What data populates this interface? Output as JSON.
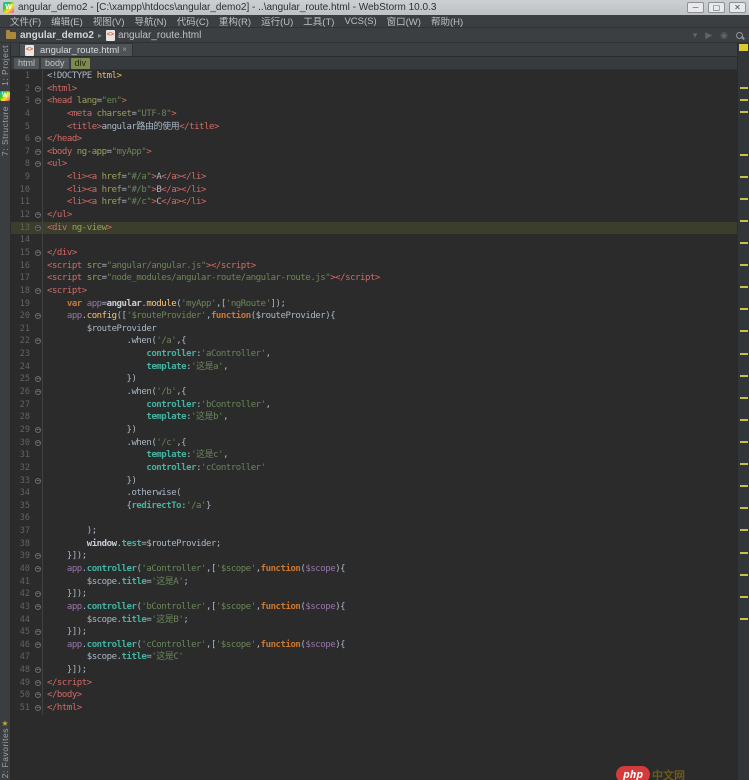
{
  "window": {
    "title": "angular_demo2 - [C:\\xampp\\htdocs\\angular_demo2] - ..\\angular_route.html - WebStorm 10.0.3",
    "minimize": "─",
    "maximize": "▢",
    "close": "✕"
  },
  "menu": {
    "items": [
      "文件(F)",
      "编辑(E)",
      "视图(V)",
      "导航(N)",
      "代码(C)",
      "重构(R)",
      "运行(U)",
      "工具(T)",
      "VCS(S)",
      "窗口(W)",
      "帮助(H)"
    ]
  },
  "navbar": {
    "project": "angular_demo2",
    "separator": "▸",
    "file": "angular_route.html",
    "file_icon_glyph": "<>",
    "right_icons": [
      "run-config-dropdown",
      "run",
      "stop",
      "search"
    ]
  },
  "tabs": [
    {
      "label": "angular_route.html",
      "close": "×",
      "active": true
    }
  ],
  "breadcrumbs": [
    {
      "label": "html",
      "selected": false
    },
    {
      "label": "body",
      "selected": false
    },
    {
      "label": "div",
      "selected": true
    }
  ],
  "tool_windows": {
    "left_top": [
      "1: Project",
      "7: Structure"
    ],
    "left_bottom": [
      "2: Favorites"
    ],
    "webstorm_badge": "W",
    "favorites_star": "★"
  },
  "editor": {
    "active_line": 13,
    "fold_lines": [
      2,
      3,
      6,
      7,
      8,
      12,
      13,
      15,
      18,
      20,
      22,
      25,
      26,
      29,
      30,
      33,
      39,
      40,
      42,
      43,
      45,
      46,
      48,
      49,
      50,
      51
    ],
    "lines": [
      [
        [
          "pl",
          "<!DOCTYPE "
        ],
        [
          "yel",
          "html>"
        ]
      ],
      [
        [
          "tag",
          "<html>"
        ]
      ],
      [
        [
          "tag",
          "<head"
        ],
        [
          "attr",
          " lang"
        ],
        [
          "pl",
          "="
        ],
        [
          "str",
          "\"en\""
        ],
        [
          "tag",
          ">"
        ]
      ],
      [
        [
          "pl",
          "    "
        ],
        [
          "tag",
          "<meta"
        ],
        [
          "attr",
          " charset"
        ],
        [
          "pl",
          "="
        ],
        [
          "str",
          "\"UTF-8\""
        ],
        [
          "tag",
          ">"
        ]
      ],
      [
        [
          "pl",
          "    "
        ],
        [
          "tag",
          "<title>"
        ],
        [
          "pl",
          "angular路由的使用"
        ],
        [
          "tag",
          "</title>"
        ]
      ],
      [
        [
          "tag",
          "</head>"
        ]
      ],
      [
        [
          "tag",
          "<body"
        ],
        [
          "attr",
          " ng-app"
        ],
        [
          "pl",
          "="
        ],
        [
          "str",
          "\"myApp\""
        ],
        [
          "tag",
          ">"
        ]
      ],
      [
        [
          "tag",
          "<ul>"
        ]
      ],
      [
        [
          "pl",
          "    "
        ],
        [
          "tag",
          "<li><a"
        ],
        [
          "attr",
          " href"
        ],
        [
          "pl",
          "="
        ],
        [
          "str",
          "\"#/a\""
        ],
        [
          "tag",
          ">"
        ],
        [
          "pl",
          "A"
        ],
        [
          "tag",
          "</a></li>"
        ]
      ],
      [
        [
          "pl",
          "    "
        ],
        [
          "tag",
          "<li><a"
        ],
        [
          "attr",
          " href"
        ],
        [
          "pl",
          "="
        ],
        [
          "str",
          "\"#/b\""
        ],
        [
          "tag",
          ">"
        ],
        [
          "pl",
          "B"
        ],
        [
          "tag",
          "</a></li>"
        ]
      ],
      [
        [
          "pl",
          "    "
        ],
        [
          "tag",
          "<li><a"
        ],
        [
          "attr",
          " href"
        ],
        [
          "pl",
          "="
        ],
        [
          "str",
          "\"#/c\""
        ],
        [
          "tag",
          ">"
        ],
        [
          "pl",
          "C"
        ],
        [
          "tag",
          "</a></li>"
        ]
      ],
      [
        [
          "tag",
          "</ul>"
        ]
      ],
      [
        [
          "tag",
          "<div"
        ],
        [
          "attr",
          " ng-view"
        ],
        [
          "tag",
          ">"
        ]
      ],
      [],
      [
        [
          "tag",
          "</div>"
        ]
      ],
      [
        [
          "tag",
          "<script"
        ],
        [
          "attr",
          " src"
        ],
        [
          "pl",
          "="
        ],
        [
          "str",
          "\"angular/angular.js\""
        ],
        [
          "tag",
          "></script>"
        ]
      ],
      [
        [
          "tag",
          "<script"
        ],
        [
          "attr",
          " src"
        ],
        [
          "pl",
          "="
        ],
        [
          "str",
          "\"node_modules/angular-route/angular-route.js\""
        ],
        [
          "tag",
          "></script>"
        ]
      ],
      [
        [
          "tag",
          "<script>"
        ]
      ],
      [
        [
          "pl",
          "    "
        ],
        [
          "kw",
          "var "
        ],
        [
          "glob",
          "app"
        ],
        [
          "pl",
          "="
        ],
        [
          "wb",
          "angular"
        ],
        [
          "pl",
          "."
        ],
        [
          "fn",
          "module"
        ],
        [
          "pl",
          "("
        ],
        [
          "str",
          "'myApp'"
        ],
        [
          "pl",
          ",["
        ],
        [
          "str",
          "'ngRoute'"
        ],
        [
          "pl",
          "]);"
        ]
      ],
      [
        [
          "pl",
          "    "
        ],
        [
          "glob",
          "app"
        ],
        [
          "pl",
          "."
        ],
        [
          "fn",
          "config"
        ],
        [
          "pl",
          "(["
        ],
        [
          "str",
          "'$routeProvider'"
        ],
        [
          "pl",
          ","
        ],
        [
          "kw",
          "function"
        ],
        [
          "pl",
          "($routeProvider){"
        ]
      ],
      [
        [
          "pl",
          "        $routeProvider"
        ]
      ],
      [
        [
          "pl",
          "                .when("
        ],
        [
          "str",
          "'/a'"
        ],
        [
          "pl",
          ",{"
        ]
      ],
      [
        [
          "pl",
          "                    "
        ],
        [
          "prop",
          "controller"
        ],
        [
          "pl",
          ":"
        ],
        [
          "str",
          "'aController'"
        ],
        [
          "pl",
          ","
        ]
      ],
      [
        [
          "pl",
          "                    "
        ],
        [
          "prop",
          "template"
        ],
        [
          "pl",
          ":"
        ],
        [
          "str",
          "'这是a'"
        ],
        [
          "pl",
          ","
        ]
      ],
      [
        [
          "pl",
          "                })"
        ]
      ],
      [
        [
          "pl",
          "                .when("
        ],
        [
          "str",
          "'/b'"
        ],
        [
          "pl",
          ",{"
        ]
      ],
      [
        [
          "pl",
          "                    "
        ],
        [
          "prop",
          "controller"
        ],
        [
          "pl",
          ":"
        ],
        [
          "str",
          "'bController'"
        ],
        [
          "pl",
          ","
        ]
      ],
      [
        [
          "pl",
          "                    "
        ],
        [
          "prop",
          "template"
        ],
        [
          "pl",
          ":"
        ],
        [
          "str",
          "'这是b'"
        ],
        [
          "pl",
          ","
        ]
      ],
      [
        [
          "pl",
          "                })"
        ]
      ],
      [
        [
          "pl",
          "                .when("
        ],
        [
          "str",
          "'/c'"
        ],
        [
          "pl",
          ",{"
        ]
      ],
      [
        [
          "pl",
          "                    "
        ],
        [
          "prop",
          "template"
        ],
        [
          "pl",
          ":"
        ],
        [
          "str",
          "'这是c'"
        ],
        [
          "pl",
          ","
        ]
      ],
      [
        [
          "pl",
          "                    "
        ],
        [
          "prop",
          "controller"
        ],
        [
          "pl",
          ":"
        ],
        [
          "str",
          "'cController'"
        ]
      ],
      [
        [
          "pl",
          "                })"
        ]
      ],
      [
        [
          "pl",
          "                .otherwise("
        ]
      ],
      [
        [
          "pl",
          "                {"
        ],
        [
          "prop",
          "redirectTo"
        ],
        [
          "pl",
          ":"
        ],
        [
          "str",
          "'/a'"
        ],
        [
          "pl",
          "}"
        ]
      ],
      [],
      [
        [
          "pl",
          "        );"
        ]
      ],
      [
        [
          "pl",
          "        "
        ],
        [
          "wb",
          "window"
        ],
        [
          "pl",
          "."
        ],
        [
          "prop",
          "test"
        ],
        [
          "pl",
          "="
        ],
        [
          "pl",
          "$routeProvider;"
        ]
      ],
      [
        [
          "pl",
          "    }]);"
        ]
      ],
      [
        [
          "pl",
          "    "
        ],
        [
          "glob",
          "app"
        ],
        [
          "pl",
          "."
        ],
        [
          "prop",
          "controller"
        ],
        [
          "pl",
          "("
        ],
        [
          "str",
          "'aController'"
        ],
        [
          "pl",
          ",["
        ],
        [
          "str",
          "'$scope'"
        ],
        [
          "pl",
          ","
        ],
        [
          "kw",
          "function"
        ],
        [
          "pl",
          "("
        ],
        [
          "glob",
          "$scope"
        ],
        [
          "pl",
          "){"
        ]
      ],
      [
        [
          "pl",
          "        $scope."
        ],
        [
          "prop",
          "title"
        ],
        [
          "pl",
          "="
        ],
        [
          "str",
          "'这是A'"
        ],
        [
          "pl",
          ";"
        ]
      ],
      [
        [
          "pl",
          "    }]);"
        ]
      ],
      [
        [
          "pl",
          "    "
        ],
        [
          "glob",
          "app"
        ],
        [
          "pl",
          "."
        ],
        [
          "prop",
          "controller"
        ],
        [
          "pl",
          "("
        ],
        [
          "str",
          "'bController'"
        ],
        [
          "pl",
          ",["
        ],
        [
          "str",
          "'$scope'"
        ],
        [
          "pl",
          ","
        ],
        [
          "kw",
          "function"
        ],
        [
          "pl",
          "("
        ],
        [
          "glob",
          "$scope"
        ],
        [
          "pl",
          "){"
        ]
      ],
      [
        [
          "pl",
          "        $scope."
        ],
        [
          "prop",
          "title"
        ],
        [
          "pl",
          "="
        ],
        [
          "str",
          "'这是B'"
        ],
        [
          "pl",
          ";"
        ]
      ],
      [
        [
          "pl",
          "    }]);"
        ]
      ],
      [
        [
          "pl",
          "    "
        ],
        [
          "glob",
          "app"
        ],
        [
          "pl",
          "."
        ],
        [
          "prop",
          "controller"
        ],
        [
          "pl",
          "("
        ],
        [
          "str",
          "'cController'"
        ],
        [
          "pl",
          ",["
        ],
        [
          "str",
          "'$scope'"
        ],
        [
          "pl",
          ","
        ],
        [
          "kw",
          "function"
        ],
        [
          "pl",
          "("
        ],
        [
          "glob",
          "$scope"
        ],
        [
          "pl",
          "){"
        ]
      ],
      [
        [
          "pl",
          "        $scope."
        ],
        [
          "prop",
          "title"
        ],
        [
          "pl",
          "="
        ],
        [
          "str",
          "'这是C'"
        ]
      ],
      [
        [
          "pl",
          "    }]);"
        ]
      ],
      [
        [
          "tag",
          "</script>"
        ]
      ],
      [
        [
          "tag",
          "</body>"
        ]
      ],
      [
        [
          "tag",
          "</html>"
        ]
      ]
    ]
  },
  "scrollbar": {
    "top_indicator_color": "#d9ca33",
    "mark_color": "#c9bd4e",
    "marks_percent": [
      6,
      7.6,
      9.2,
      15,
      18,
      21,
      24,
      27,
      30,
      33,
      36,
      39,
      42,
      45,
      48,
      51,
      54,
      57,
      60,
      63,
      66,
      69,
      72,
      75,
      78
    ]
  },
  "watermark": {
    "badge": "php",
    "text": "中文网"
  },
  "colors": {
    "editor_bg": "#2b2b2b",
    "chrome_bg": "#3c3f41",
    "caret_line": "#3b3e2a",
    "tag": "#d26b68",
    "attribute": "#9aa157",
    "string": "#6a8759",
    "keyword": "#cc7832",
    "function_call": "#ffc66b",
    "property": "#45b3a2",
    "global_var": "#9876aa",
    "line_number": "#606366",
    "breadcrumb_selected": "#7f8a4f"
  }
}
